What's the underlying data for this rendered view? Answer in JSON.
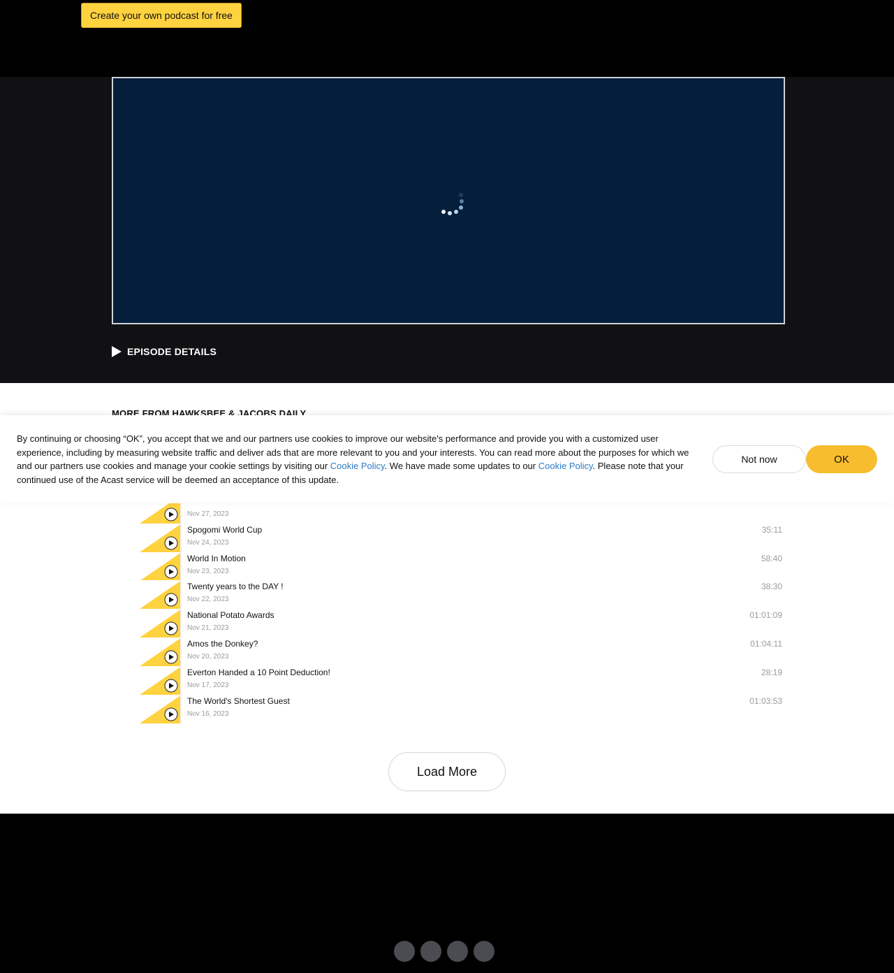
{
  "header": {
    "create_button": "Create your own podcast for free"
  },
  "player": {
    "episode_details_label": "EPISODE DETAILS"
  },
  "more_from": "MORE FROM HAWKSBEE & JACOBS DAILY",
  "episodes": [
    {
      "title": "",
      "date": "Nov 27, 2023",
      "duration": ""
    },
    {
      "title": "Spogomi World Cup",
      "date": "Nov 24, 2023",
      "duration": "35:11"
    },
    {
      "title": "World In Motion",
      "date": "Nov 23, 2023",
      "duration": "58:40"
    },
    {
      "title": "Twenty years to the DAY !",
      "date": "Nov 22, 2023",
      "duration": "38:30"
    },
    {
      "title": "National Potato Awards",
      "date": "Nov 21, 2023",
      "duration": "01:01:09"
    },
    {
      "title": "Amos the Donkey?",
      "date": "Nov 20, 2023",
      "duration": "01:04:11"
    },
    {
      "title": "Everton Handed a 10 Point Deduction!",
      "date": "Nov 17, 2023",
      "duration": "28:19"
    },
    {
      "title": "The World's Shortest Guest",
      "date": "Nov 16, 2023",
      "duration": "01:03:53"
    }
  ],
  "load_more": "Load More",
  "cookie": {
    "text_1": "By continuing or choosing “OK”, you accept that we and our partners use cookies to improve our website's performance and provide you with a customized user experience, including by measuring website traffic and deliver ads that are more relevant to you and your interests. You can read more about the purposes for which we and our partners use cookies and manage your cookie settings by visiting our ",
    "link_1": "Cookie Policy",
    "text_2": ". We have made some updates to our ",
    "link_2": "Cookie Policy",
    "text_3": ". Please note that your continued use of the Acast service will be deemed an acceptance of this update.",
    "not_now": "Not now",
    "ok": "OK"
  },
  "footer": {
    "social_icons": [
      "social-icon",
      "social-icon",
      "social-icon",
      "social-icon"
    ]
  },
  "colors": {
    "accent_yellow": "#ffd23f",
    "ok_button": "#f7bd2f",
    "player_bg": "#041e3b",
    "link_blue": "#2e7bc6"
  }
}
